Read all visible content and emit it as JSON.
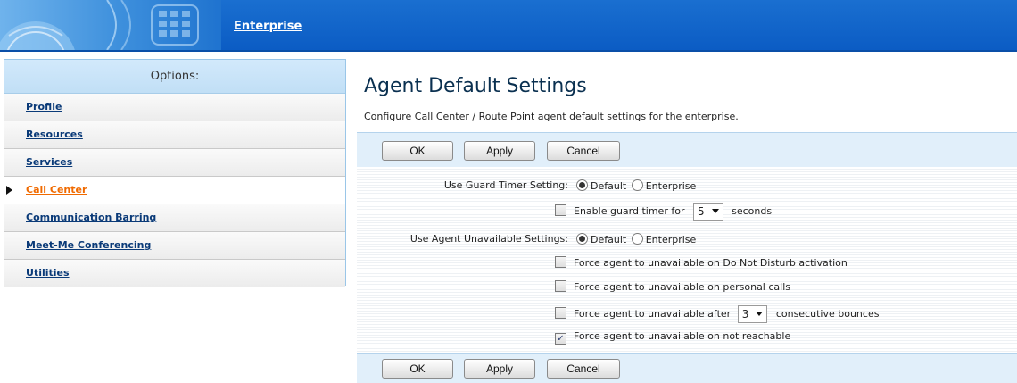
{
  "header": {
    "enterprise_link": "Enterprise"
  },
  "sidebar": {
    "title": "Options:",
    "items": [
      {
        "label": "Profile"
      },
      {
        "label": "Resources"
      },
      {
        "label": "Services"
      },
      {
        "label": "Call Center",
        "active": true
      },
      {
        "label": "Communication Barring"
      },
      {
        "label": "Meet-Me Conferencing"
      },
      {
        "label": "Utilities"
      }
    ]
  },
  "main": {
    "title": "Agent Default Settings",
    "description": "Configure Call Center / Route Point agent default settings for the enterprise.",
    "buttons": {
      "ok": "OK",
      "apply": "Apply",
      "cancel": "Cancel"
    },
    "guard_timer": {
      "label": "Use Guard Timer Setting:",
      "option_default": "Default",
      "option_enterprise": "Enterprise",
      "selected": "Default",
      "enable_label": "Enable guard timer for",
      "enable_checked": false,
      "seconds_value": "5",
      "seconds_suffix": "seconds"
    },
    "agent_unavailable": {
      "label": "Use Agent Unavailable Settings:",
      "option_default": "Default",
      "option_enterprise": "Enterprise",
      "selected": "Default",
      "dnd_label": "Force agent to unavailable on Do Not Disturb activation",
      "dnd_checked": false,
      "personal_label": "Force agent to unavailable on personal calls",
      "personal_checked": false,
      "bounces_prefix": "Force agent to unavailable after",
      "bounces_value": "3",
      "bounces_suffix": "consecutive bounces",
      "bounces_checked": false,
      "not_reachable_label": "Force agent to unavailable on not reachable",
      "not_reachable_checked": true
    }
  },
  "colors": {
    "header_blue": "#0b5cc4",
    "sidebar_title_bg": "#c1dff6",
    "active_link": "#f06a00",
    "link": "#0a3a78",
    "button_bar_bg": "#e1effa"
  }
}
